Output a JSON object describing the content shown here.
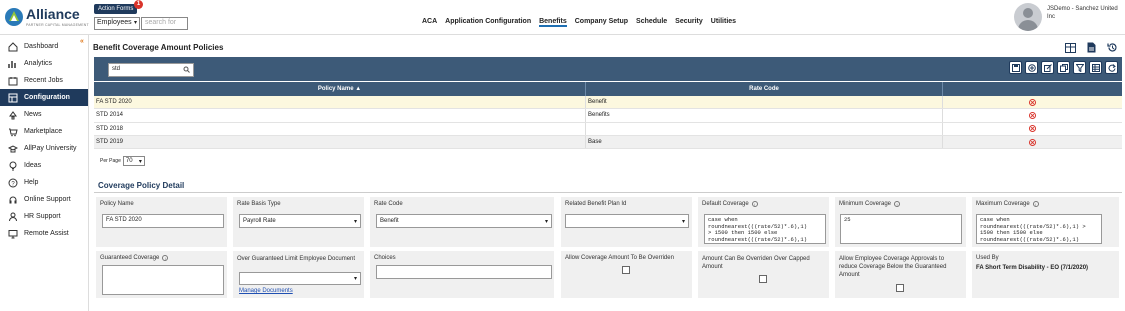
{
  "app": {
    "brand": "Alliance",
    "tagline": "PARTNER CAPITAL MANAGEMENT"
  },
  "action_forms": {
    "label": "Action Forms",
    "badge_count": "1",
    "select_value": "Employees",
    "search_placeholder": "search for"
  },
  "topnav": [
    {
      "label": "ACA",
      "active": false
    },
    {
      "label": "Application Configuration",
      "active": false
    },
    {
      "label": "Benefits",
      "active": true
    },
    {
      "label": "Company Setup",
      "active": false
    },
    {
      "label": "Schedule",
      "active": false
    },
    {
      "label": "Security",
      "active": false
    },
    {
      "label": "Utilities",
      "active": false
    }
  ],
  "user": {
    "name": "JSDemo - Sanchez United Inc"
  },
  "sidebar": {
    "items": [
      {
        "label": "Dashboard",
        "icon": "dashboard-icon"
      },
      {
        "label": "Analytics",
        "icon": "analytics-icon"
      },
      {
        "label": "Recent Jobs",
        "icon": "recent-jobs-icon"
      },
      {
        "label": "Configuration",
        "icon": "configuration-icon",
        "active": true
      },
      {
        "label": "News",
        "icon": "news-icon"
      },
      {
        "label": "Marketplace",
        "icon": "marketplace-icon"
      },
      {
        "label": "AllPay University",
        "icon": "university-icon"
      },
      {
        "label": "Ideas",
        "icon": "lightbulb-icon"
      },
      {
        "label": "Help",
        "icon": "help-icon"
      },
      {
        "label": "Online Support",
        "icon": "support-icon"
      },
      {
        "label": "HR Support",
        "icon": "hr-support-icon"
      },
      {
        "label": "Remote Assist",
        "icon": "remote-assist-icon"
      }
    ]
  },
  "page": {
    "title": "Benefit Coverage Amount Policies"
  },
  "grid": {
    "search_value": "std",
    "columns": [
      "Policy Name ▲",
      "Rate Code",
      ""
    ],
    "rows": [
      {
        "policy_name": "FA STD 2020",
        "rate_code": "Benefit",
        "selected": true
      },
      {
        "policy_name": "STD 2014",
        "rate_code": "Benefits",
        "selected": false
      },
      {
        "policy_name": "STD 2018",
        "rate_code": "",
        "selected": false
      },
      {
        "policy_name": "STD 2019",
        "rate_code": "Base",
        "selected": false
      }
    ],
    "per_page_label": "Per Page",
    "per_page_value": "70"
  },
  "detail": {
    "section_title": "Coverage Policy Detail",
    "policy_name": {
      "label": "Policy Name",
      "value": "FA STD 2020"
    },
    "rate_basis_type": {
      "label": "Rate Basis Type",
      "value": "Payroll Rate"
    },
    "rate_code": {
      "label": "Rate Code",
      "value": "Benefit"
    },
    "related_benefit_plan": {
      "label": "Related Benefit Plan Id",
      "value": ""
    },
    "default_coverage": {
      "label": "Default Coverage",
      "line1": "case when",
      "line2": "roundnearest(((rate/52)*.6),1)",
      "line3": "> 1500 then 1500 else",
      "line4": "roundnearest(((rate/52)*.6),1)"
    },
    "minimum_coverage": {
      "label": "Minimum Coverage",
      "value": "25"
    },
    "maximum_coverage": {
      "label": "Maximum Coverage",
      "line1": "case when",
      "line2": "roundnearest(((rate/52)*.6),1) >",
      "line3": "1500 then 1500 else",
      "line4": "roundnearest(((rate/52)*.6),1)"
    },
    "guaranteed_coverage": {
      "label": "Guaranteed Coverage",
      "value": ""
    },
    "over_guaranteed_doc": {
      "label": "Over Guaranteed Limit Employee Document",
      "value": "",
      "link": "Manage Documents"
    },
    "choices": {
      "label": "Choices",
      "value": ""
    },
    "allow_override": {
      "label": "Allow Coverage Amount To Be Overriden"
    },
    "override_capped": {
      "label": "Amount Can Be Overriden Over Capped Amount"
    },
    "allow_approvals": {
      "label": "Allow Employee Coverage Approvals to reduce Coverage Below the Guaranteed Amount"
    },
    "used_by": {
      "label": "Used By",
      "value": "FA Short Term Disability - EO (7/1/2020)"
    }
  }
}
